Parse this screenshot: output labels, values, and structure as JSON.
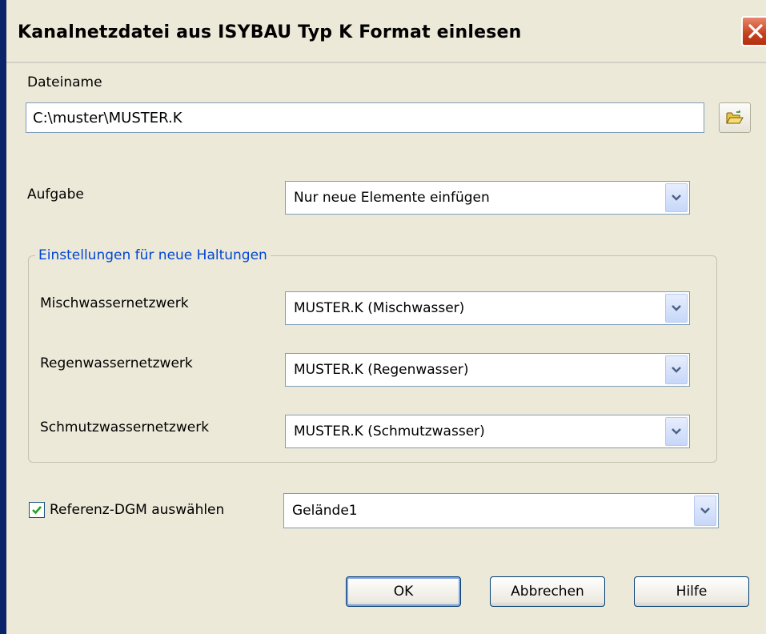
{
  "dialog": {
    "title": "Kanalnetzdatei aus ISYBAU Typ K Format einlesen"
  },
  "file": {
    "label": "Dateiname",
    "value": "C:\\muster\\MUSTER.K"
  },
  "task": {
    "label": "Aufgabe",
    "value": "Nur neue Elemente einfügen"
  },
  "group": {
    "title": "Einstellungen für neue Haltungen",
    "rows": [
      {
        "label": "Mischwassernetzwerk",
        "value": "MUSTER.K (Mischwasser)"
      },
      {
        "label": "Regenwassernetzwerk",
        "value": "MUSTER.K (Regenwasser)"
      },
      {
        "label": "Schmutzwassernetzwerk",
        "value": "MUSTER.K (Schmutzwasser)"
      }
    ]
  },
  "reference": {
    "checked": true,
    "label": "Referenz-DGM auswählen",
    "value": "Gelände1"
  },
  "buttons": {
    "ok": "OK",
    "cancel": "Abbrechen",
    "help": "Hilfe"
  },
  "icons": {
    "close": "close-icon",
    "browse": "folder-open-icon",
    "dropdown": "chevron-down-icon",
    "check": "check-icon"
  },
  "colors": {
    "dialog_bg": "#ece9d8",
    "group_title": "#0046d5",
    "close_button": "#c5411e",
    "checkmark": "#21a121"
  }
}
